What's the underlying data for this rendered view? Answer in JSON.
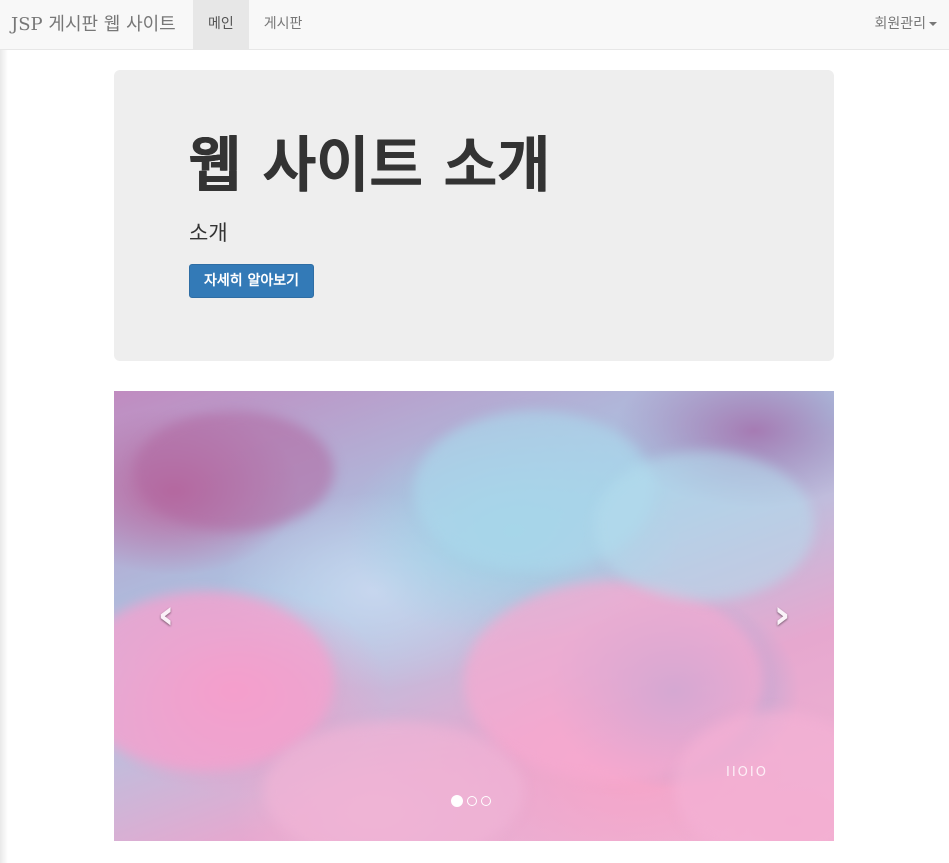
{
  "navbar": {
    "brand": "JSP 게시판 웹 사이트",
    "links": [
      {
        "label": "메인",
        "active": true
      },
      {
        "label": "게시판",
        "active": false
      }
    ],
    "right_menu": "회원관리"
  },
  "jumbotron": {
    "title": "웹 사이트 소개",
    "subtitle": "소개",
    "button_label": "자세히 알아보기"
  },
  "carousel": {
    "prev_icon": "chevron-left-icon",
    "next_icon": "chevron-right-icon",
    "prev_glyph": "‹",
    "next_glyph": "›",
    "slide_count": 3,
    "active_index": 0,
    "watermark": "IIOIO"
  },
  "colors": {
    "navbar_bg": "#f8f8f8",
    "jumbotron_bg": "#eeeeee",
    "primary": "#337ab7"
  }
}
